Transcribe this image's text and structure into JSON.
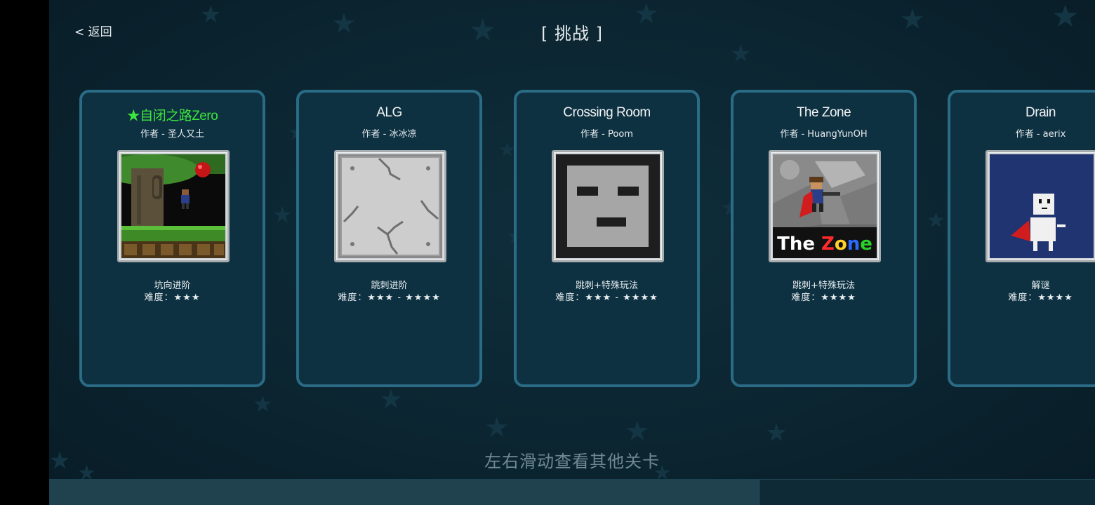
{
  "header": {
    "back_label": "< 返回",
    "title": "[ 挑战 ]"
  },
  "levels": [
    {
      "name": "★自闭之路Zero",
      "author": "作者 - 圣人又土",
      "type": "坑向进阶",
      "difficulty": "难度：★★★",
      "featured": true,
      "thumb": "forest-tree-scene"
    },
    {
      "name": "ALG",
      "author": "作者 - 冰冰凉",
      "type": "跳刺进阶",
      "difficulty": "难度：★★★ - ★★★★",
      "featured": false,
      "thumb": "cracked-tile"
    },
    {
      "name": "Crossing Room",
      "author": "作者 - Poom",
      "type": "跳刺+特殊玩法",
      "difficulty": "难度：★★★ - ★★★★",
      "featured": false,
      "thumb": "block-face"
    },
    {
      "name": "The Zone",
      "author": "作者 - HuangYunOH",
      "type": "跳刺+特殊玩法",
      "difficulty": "难度：★★★★",
      "featured": false,
      "thumb": "the-zone-logo",
      "thumb_text": "The Zone"
    },
    {
      "name": "Drain",
      "author": "作者 - aerix",
      "type": "解谜",
      "difficulty": "难度：★★★★",
      "featured": false,
      "thumb": "white-block-hero"
    }
  ],
  "footer": {
    "hint": "左右滑动查看其他关卡"
  },
  "scroll": {
    "position_fraction": 0.68
  },
  "colors": {
    "background": "#0b2531",
    "card_border": "#2a6b85",
    "featured_name": "#3de53d",
    "hint_text": "#6f8a95"
  }
}
